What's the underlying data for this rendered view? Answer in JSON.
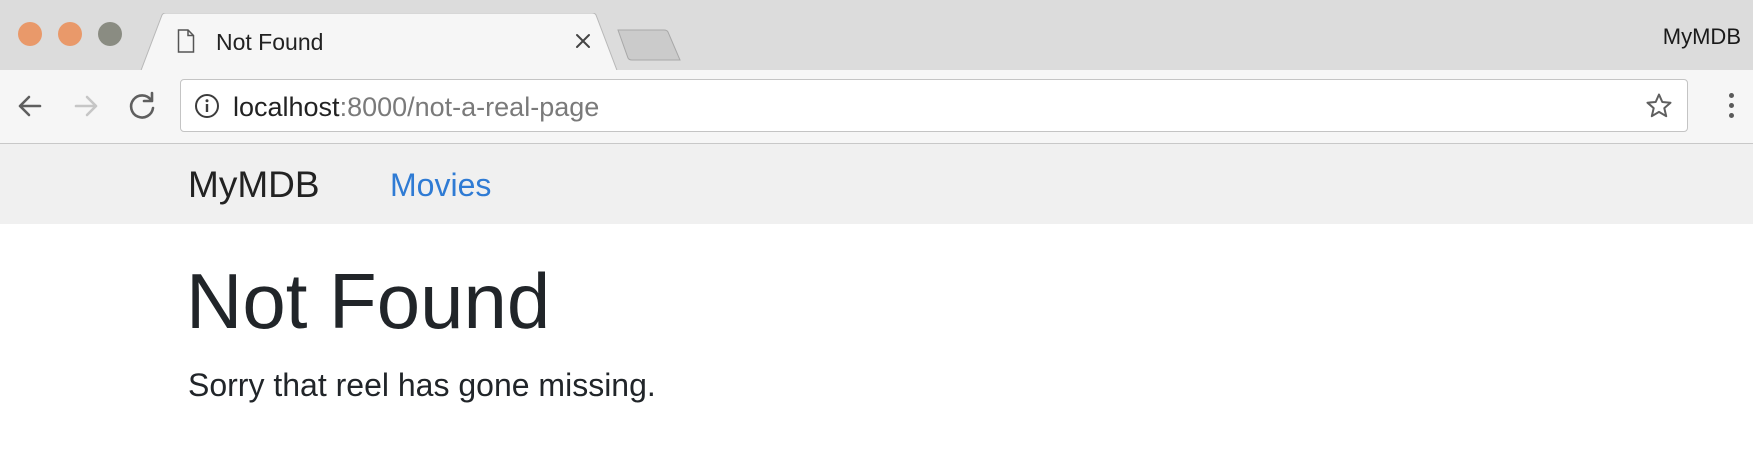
{
  "browser": {
    "tab": {
      "title": "Not Found",
      "icon": "document-icon",
      "close_icon": "close-icon"
    },
    "new_tab_icon": "new-tab-icon",
    "profile_name": "MyMDB",
    "toolbar": {
      "back_icon": "back-arrow-icon",
      "forward_icon": "forward-arrow-icon",
      "reload_icon": "reload-icon",
      "info_icon": "info-icon",
      "url_host": "localhost",
      "url_rest": ":8000/not-a-real-page",
      "bookmark_icon": "star-icon",
      "menu_icon": "more-vertical-icon"
    }
  },
  "site": {
    "brand": "MyMDB",
    "nav": [
      {
        "label": "Movies"
      }
    ]
  },
  "content": {
    "heading": "Not Found",
    "message": "Sorry that reel has gone missing."
  },
  "colors": {
    "link": "#2f7bd4",
    "text": "#212529",
    "navbar_bg": "#f0f0f0",
    "traffic_close": "#e9996a",
    "traffic_min": "#e9996a",
    "traffic_max": "#8a8c82"
  }
}
